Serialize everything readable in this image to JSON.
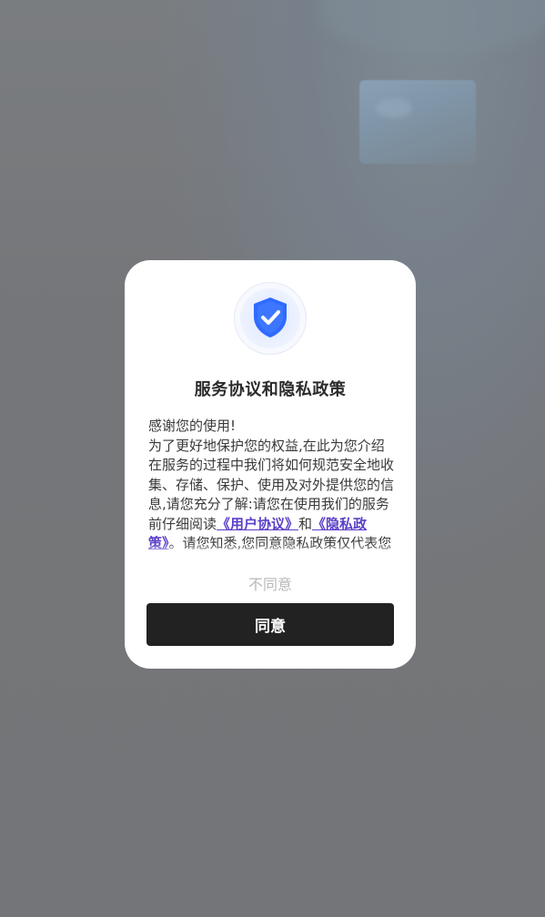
{
  "colors": {
    "overlay": "#747578",
    "modal_bg": "#ffffff",
    "shield_blue": "#2f6bff",
    "link": "#5b3fc8",
    "agree_bg": "#222222",
    "disagree_text": "#b8b8b8"
  },
  "dialog": {
    "icon": "shield-check-icon",
    "title": "服务协议和隐私政策",
    "greeting": "感谢您的使用!",
    "intro": "为了更好地保护您的权益,在此为您介绍在服务的过程中我们将如何规范安全地收集、存储、保护、使用及对外提供您的信息,请您充分了解:请您在使用我们的服务前仔细阅读",
    "user_agreement_link": "《用户协议》",
    "and_text": "和",
    "privacy_policy_link": "《隐私政策》",
    "continuation": "。请您知悉,您同意隐私政策仅代表您已了解应用提供的功能,以及功能运行所需的必要个人信息",
    "disagree_label": "不同意",
    "agree_label": "同意"
  }
}
